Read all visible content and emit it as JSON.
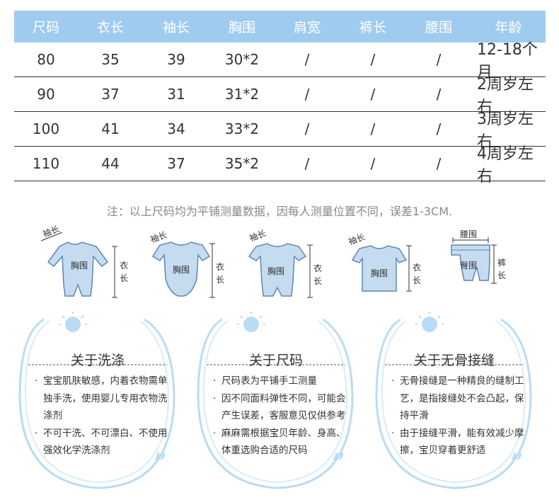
{
  "size_table": {
    "headers": [
      "尺码",
      "衣长",
      "袖长",
      "胸围",
      "肩宽",
      "裤长",
      "腰围",
      "年龄"
    ],
    "rows": [
      [
        "80",
        "35",
        "39",
        "30*2",
        "/",
        "/",
        "/",
        "12-18个月"
      ],
      [
        "90",
        "37",
        "31",
        "31*2",
        "/",
        "/",
        "/",
        "2周岁左右"
      ],
      [
        "100",
        "41",
        "34",
        "33*2",
        "/",
        "/",
        "/",
        "3周岁左右"
      ],
      [
        "110",
        "44",
        "37",
        "35*2",
        "/",
        "/",
        "/",
        "4周岁左右"
      ]
    ]
  },
  "note": "注：以上尺码均为平铺测量数据，因每人测量位置不同，误差1-3CM.",
  "diagrams": [
    {
      "top_label": "袖长",
      "center_label": "胸围",
      "side_label": "衣长"
    },
    {
      "top_label": "袖长",
      "center_label": "胸围",
      "side_label": "衣长"
    },
    {
      "top_label": "袖长",
      "center_label": "胸围",
      "side_label": "衣长"
    },
    {
      "top_label": "袖长",
      "center_label": "胸围",
      "side_label": "衣长"
    },
    {
      "top_label": "腰围",
      "center_label": "臀围",
      "side_label": "裤长"
    }
  ],
  "cards": [
    {
      "title": "关于洗涤",
      "items": [
        "宝宝肌肤敏感，内着衣物需单独手洗，使用婴儿专用衣物洗涤剂",
        "不可干洗、不可漂白、不使用强效化学洗涤剂"
      ]
    },
    {
      "title": "关于尺码",
      "items": [
        "尺码表为平铺手工测量",
        "因不同面料弹性不同，可能会产生误差，客服意见仅供参考",
        "麻麻需根据宝贝年龄、身高、体重选购合适的尺码"
      ]
    },
    {
      "title": "关于无骨接缝",
      "items": [
        "无骨接缝是一种精良的缝制工艺，是指接缝处不会凸起，保持平滑",
        "由于接缝平滑，能有效减少摩擦，宝贝穿着更舒适"
      ]
    }
  ],
  "colors": {
    "header_bg": "#9fcbef",
    "garment_fill": "#c5dcf0",
    "garment_stroke": "#5f86b0",
    "accent_light": "#b9dcf5"
  }
}
